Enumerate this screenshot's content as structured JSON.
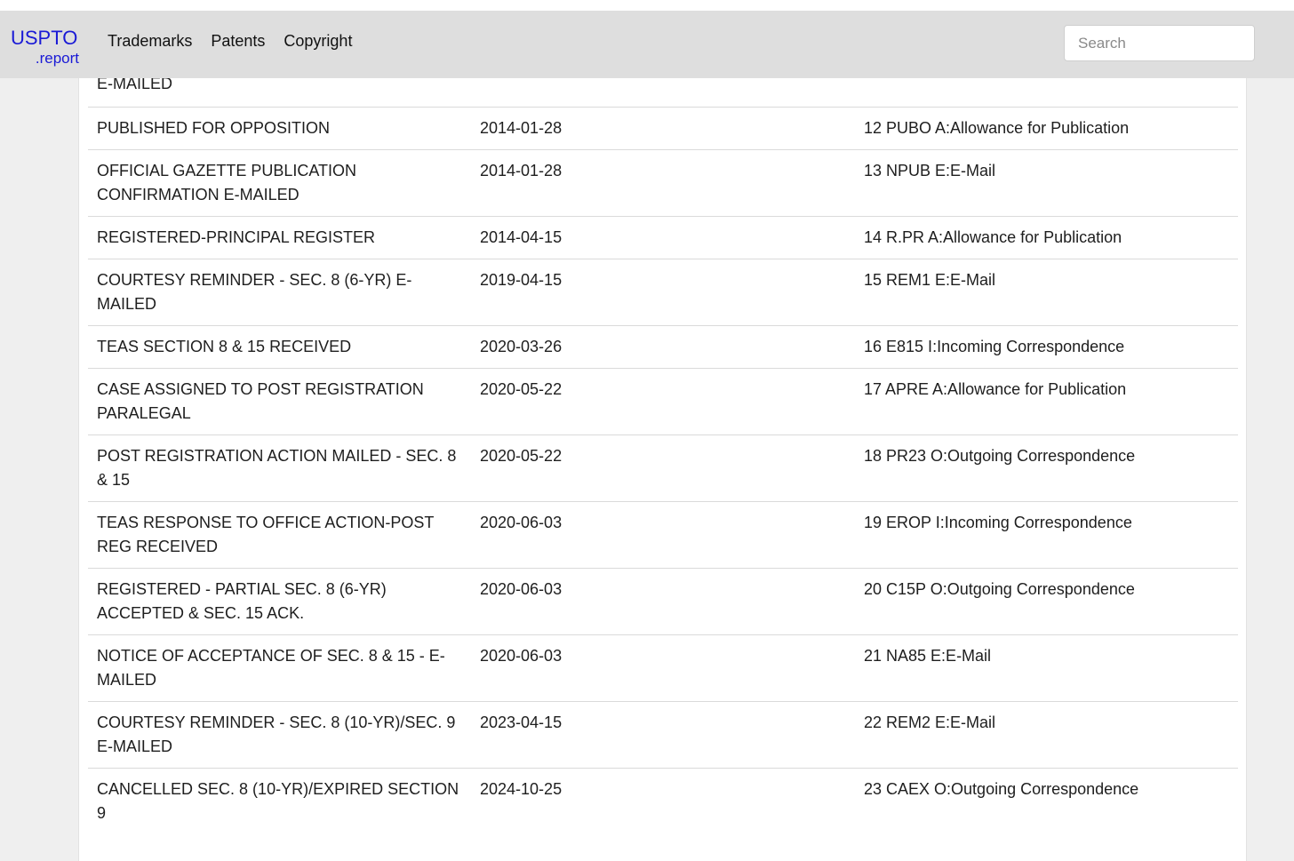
{
  "navbar": {
    "brand_main": "USPTO",
    "brand_sub": ".report",
    "links": [
      "Trademarks",
      "Patents",
      "Copyright"
    ],
    "search_placeholder": "Search"
  },
  "prosecution_history": {
    "partial_top_row": {
      "description": "E-MAILED",
      "date": "",
      "event": ""
    },
    "rows": [
      {
        "description": "PUBLISHED FOR OPPOSITION",
        "date": "2014-01-28",
        "event": "12 PUBO A:Allowance for Publication"
      },
      {
        "description": "OFFICIAL GAZETTE PUBLICATION CONFIRMATION E-MAILED",
        "date": "2014-01-28",
        "event": "13 NPUB E:E-Mail"
      },
      {
        "description": "REGISTERED-PRINCIPAL REGISTER",
        "date": "2014-04-15",
        "event": "14 R.PR A:Allowance for Publication"
      },
      {
        "description": "COURTESY REMINDER - SEC. 8 (6-YR) E-MAILED",
        "date": "2019-04-15",
        "event": "15 REM1 E:E-Mail"
      },
      {
        "description": "TEAS SECTION 8 & 15 RECEIVED",
        "date": "2020-03-26",
        "event": "16 E815 I:Incoming Correspondence"
      },
      {
        "description": "CASE ASSIGNED TO POST REGISTRATION PARALEGAL",
        "date": "2020-05-22",
        "event": "17 APRE A:Allowance for Publication"
      },
      {
        "description": "POST REGISTRATION ACTION MAILED - SEC. 8 & 15",
        "date": "2020-05-22",
        "event": "18 PR23 O:Outgoing Correspondence"
      },
      {
        "description": "TEAS RESPONSE TO OFFICE ACTION-POST REG RECEIVED",
        "date": "2020-06-03",
        "event": "19 EROP I:Incoming Correspondence"
      },
      {
        "description": "REGISTERED - PARTIAL SEC. 8 (6-YR) ACCEPTED & SEC. 15 ACK.",
        "date": "2020-06-03",
        "event": "20 C15P O:Outgoing Correspondence"
      },
      {
        "description": "NOTICE OF ACCEPTANCE OF SEC. 8 & 15 - E-MAILED",
        "date": "2020-06-03",
        "event": "21 NA85 E:E-Mail"
      },
      {
        "description": "COURTESY REMINDER - SEC. 8 (10-YR)/SEC. 9 E-MAILED",
        "date": "2023-04-15",
        "event": "22 REM2 E:E-Mail"
      },
      {
        "description": "CANCELLED SEC. 8 (10-YR)/EXPIRED SECTION 9",
        "date": "2024-10-25",
        "event": "23 CAEX O:Outgoing Correspondence"
      }
    ]
  }
}
